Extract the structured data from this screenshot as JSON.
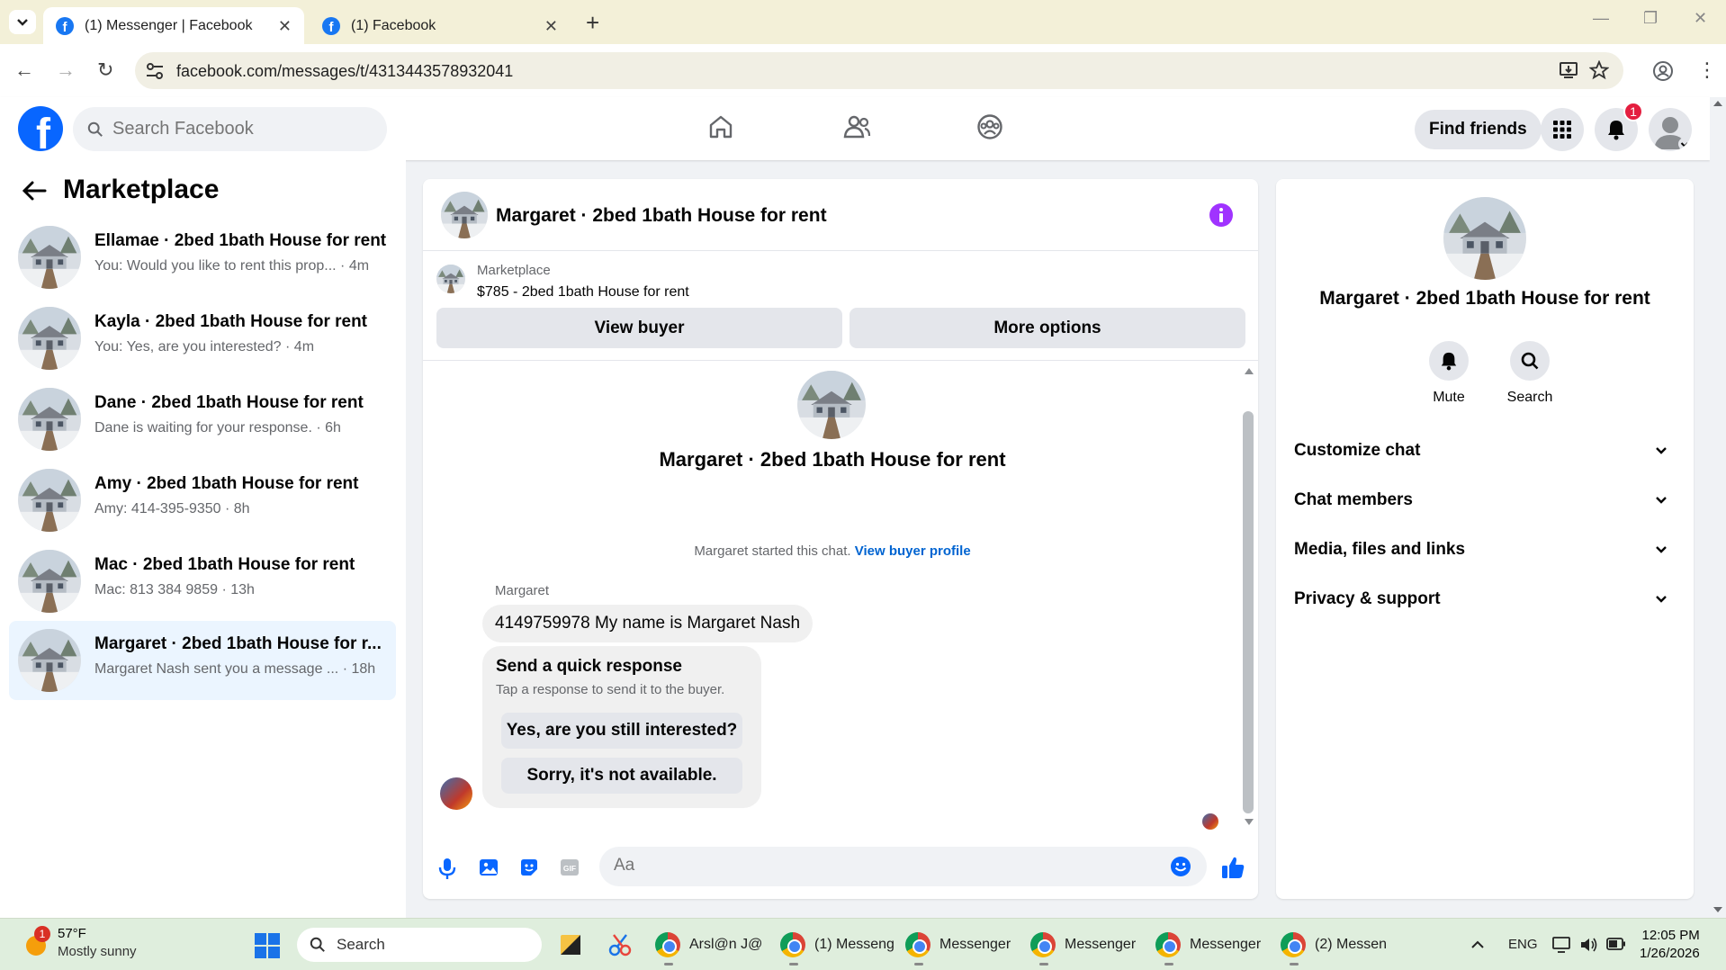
{
  "browser": {
    "tabs": [
      {
        "title": "(1) Messenger | Facebook",
        "active": true
      },
      {
        "title": "(1) Facebook",
        "active": false
      }
    ],
    "url": "facebook.com/messages/t/4313443578932041"
  },
  "fb_header": {
    "search_placeholder": "Search Facebook",
    "find_friends": "Find friends",
    "notification_count": "1",
    "brand_color": "#0866ff"
  },
  "sidebar": {
    "title": "Marketplace",
    "conversations": [
      {
        "title": "Ellamae · 2bed 1bath House for rent",
        "snippet": "You: Would you like to rent this prop... · 4m",
        "selected": false
      },
      {
        "title": "Kayla · 2bed 1bath House for rent",
        "snippet": "You: Yes, are you interested? · 4m",
        "selected": false
      },
      {
        "title": "Dane · 2bed 1bath House for rent",
        "snippet": "Dane is waiting for your response. · 6h",
        "selected": false
      },
      {
        "title": "Amy · 2bed 1bath House for rent",
        "snippet": "Amy: 414-395-9350 · 8h",
        "selected": false
      },
      {
        "title": "Mac · 2bed 1bath House for rent",
        "snippet": "Mac: 813 384 9859 · 13h",
        "selected": false
      },
      {
        "title": "Margaret · 2bed 1bath House for r...",
        "snippet": "Margaret Nash sent you a message ... · 18h",
        "selected": true
      }
    ]
  },
  "chat": {
    "title": "Margaret · 2bed 1bath House for rent",
    "marketplace_label": "Marketplace",
    "listing": "$785 - 2bed 1bath House for rent",
    "view_buyer": "View buyer",
    "more_options": "More options",
    "conversation_name": "Margaret · 2bed 1bath House for rent",
    "started_text": "Margaret started this chat.",
    "view_buyer_profile": "View buyer profile",
    "sender": "Margaret",
    "message": "4149759978 My name is Margaret Nash",
    "quick_response_title": "Send a quick response",
    "quick_response_sub": "Tap a response to send it to the buyer.",
    "quick_responses": [
      "Yes, are you still interested?",
      "Sorry, it's not available."
    ],
    "composer_placeholder": "Aa",
    "gif_label": "GIF",
    "accent_color": "#0866ff",
    "info_color": "#a033ff"
  },
  "details": {
    "name": "Margaret · 2bed 1bath House for rent",
    "actions": [
      {
        "label": "Mute"
      },
      {
        "label": "Search"
      }
    ],
    "sections": [
      "Customize chat",
      "Chat members",
      "Media, files and links",
      "Privacy & support"
    ]
  },
  "taskbar": {
    "weather_temp": "57°F",
    "weather_desc": "Mostly sunny",
    "weather_badge": "1",
    "search_placeholder": "Search",
    "apps": [
      {
        "label": "Arsl@n J@"
      },
      {
        "label": "(1) Messeng"
      },
      {
        "label": "Messenger"
      },
      {
        "label": "Messenger"
      },
      {
        "label": "Messenger"
      },
      {
        "label": "(2) Messen"
      }
    ],
    "language": "ENG",
    "time": "12:05 PM",
    "date": "1/26/2026"
  }
}
